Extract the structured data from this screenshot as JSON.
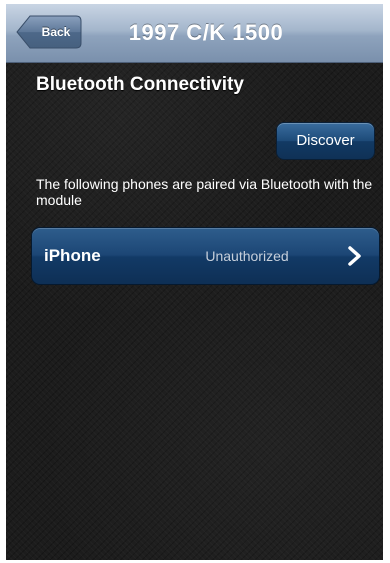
{
  "navbar": {
    "back_label": "Back",
    "title": "1997 C/K 1500"
  },
  "section": {
    "title": "Bluetooth Connectivity"
  },
  "discover": {
    "label": "Discover"
  },
  "description": "The following phones are paired via Bluetooth with the module",
  "paired_devices": [
    {
      "name": "iPhone",
      "status": "Unauthorized",
      "icon": "chevron-right-icon"
    }
  ],
  "colors": {
    "navbar": "#9fb2c9",
    "background": "#1c1c1c",
    "button_blue": "#1d4a78",
    "text": "#ffffff"
  }
}
